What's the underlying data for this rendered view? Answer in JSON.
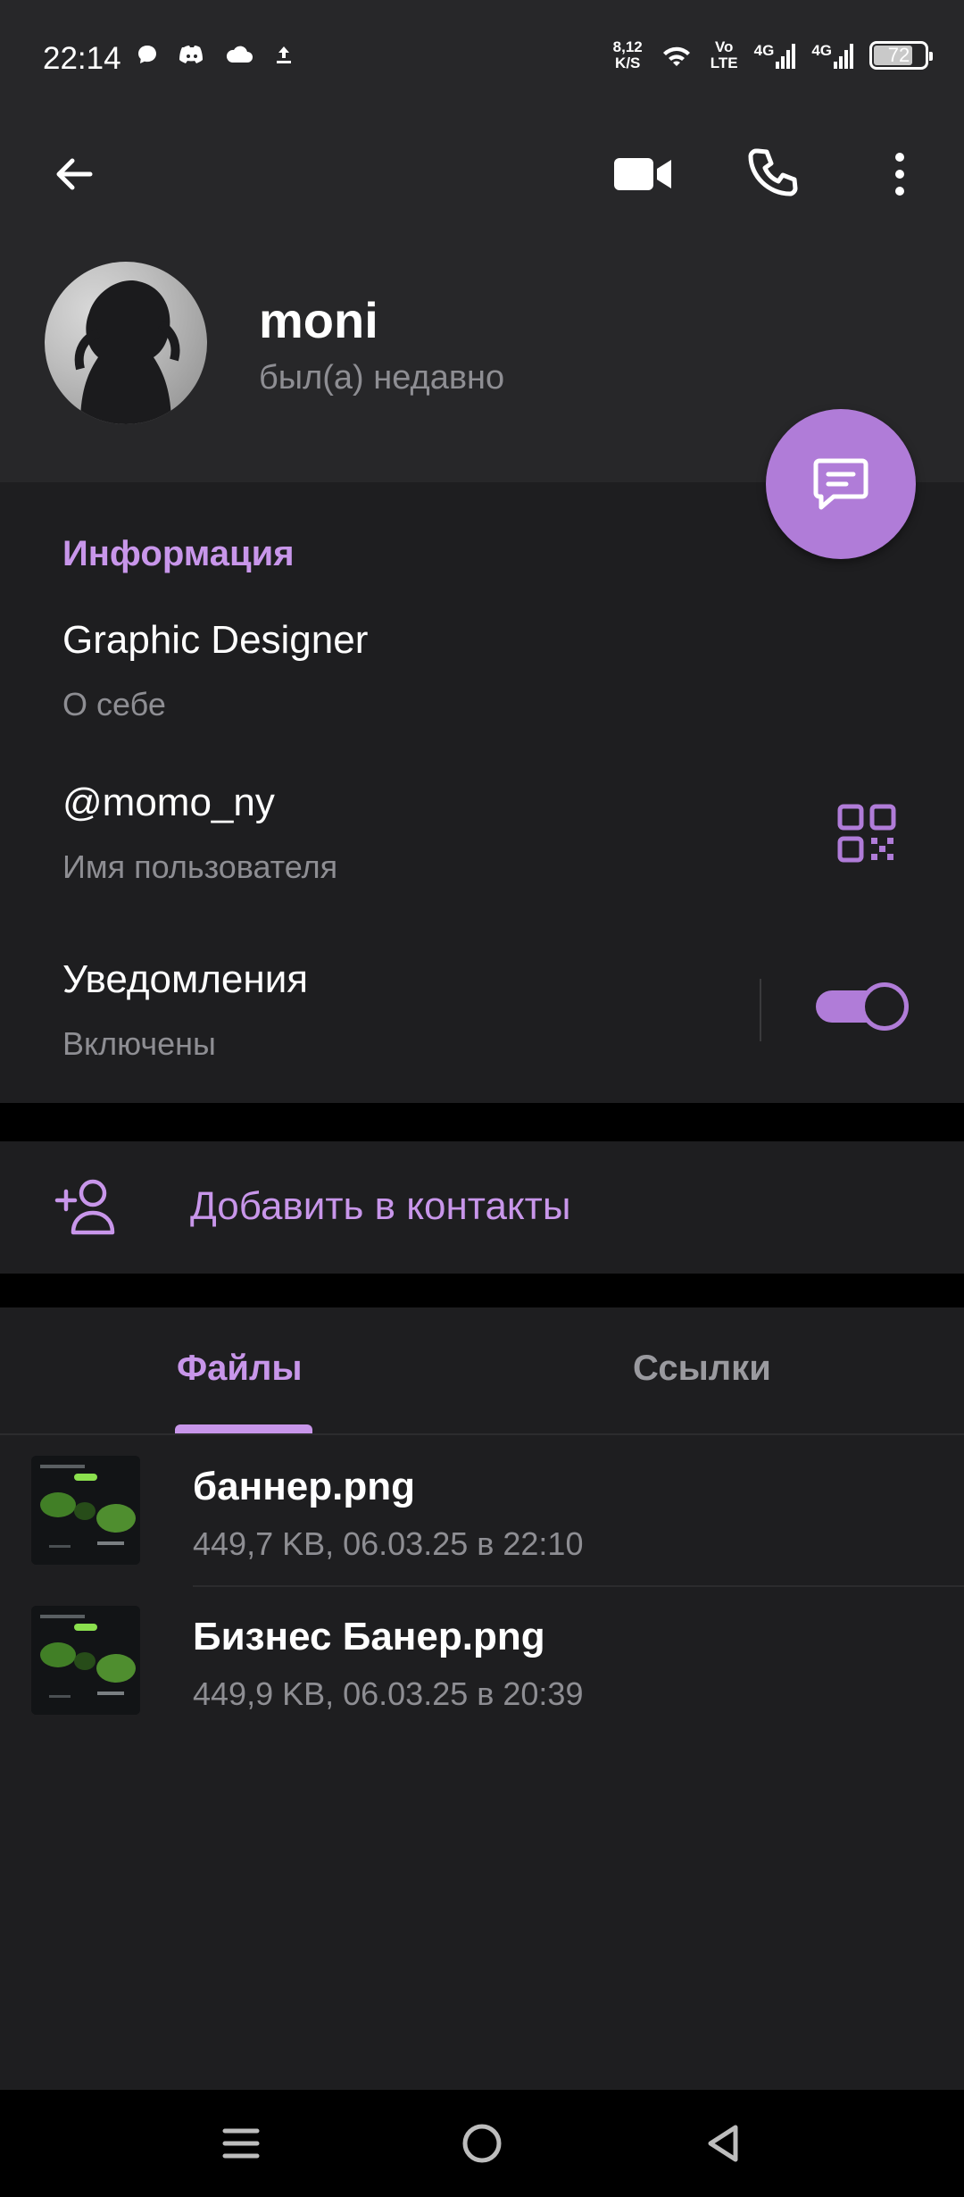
{
  "status_bar": {
    "time": "22:14",
    "speed_value": "8,12",
    "speed_unit": "K/S",
    "volte_top": "Vo",
    "volte_bottom": "LTE",
    "net1": "4G",
    "net2": "4G",
    "battery": "72"
  },
  "header": {
    "name": "moni",
    "status": "был(а) недавно"
  },
  "info": {
    "section_title": "Информация",
    "bio_value": "Graphic Designer",
    "bio_label": "О себе",
    "username_value": "@momo_ny",
    "username_label": "Имя пользователя",
    "notifications_value": "Уведомления",
    "notifications_label": "Включены",
    "notifications_enabled": true
  },
  "add_contact": {
    "label": "Добавить в контакты"
  },
  "tabs": [
    {
      "label": "Файлы",
      "active": true
    },
    {
      "label": "Ссылки",
      "active": false
    }
  ],
  "files": [
    {
      "name": "баннер.png",
      "meta": "449,7 KB, 06.03.25 в 22:10"
    },
    {
      "name": "Бизнес Банер.png",
      "meta": "449,9 KB, 06.03.25 в 20:39"
    }
  ],
  "colors": {
    "accent": "#c896ea",
    "fab": "#b07cd8",
    "background": "#1e1e20",
    "header_bg": "#272729",
    "secondary_text": "#8e8e93"
  },
  "icons": {
    "back": "arrow-left-icon",
    "video": "video-camera-icon",
    "call": "phone-icon",
    "more": "more-vertical-icon",
    "fab": "message-icon",
    "qr": "qr-code-icon",
    "add_contact": "add-person-icon"
  }
}
